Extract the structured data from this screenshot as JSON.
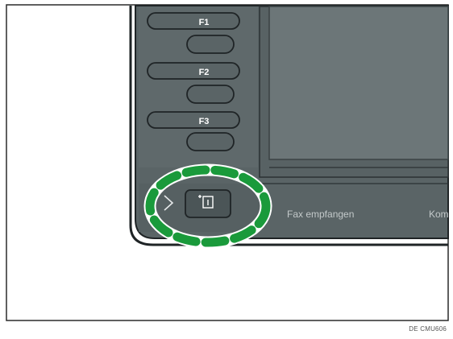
{
  "panel": {
    "function_keys": [
      {
        "label": "F1"
      },
      {
        "label": "F2"
      },
      {
        "label": "F3"
      }
    ],
    "screen_tabs": {
      "fax_received": "Fax empfangen",
      "truncated": "Kom"
    },
    "info_key_icon": "info-key-icon",
    "left_arrow_icon": "chevron-right-icon"
  },
  "highlight": {
    "color": "#1a9a3b",
    "style": "dashed-ellipse"
  },
  "image_code": "DE CMU606",
  "colors": {
    "panel_body": "#5a6466",
    "panel_border": "#2b3133",
    "screen": "#6b7577",
    "key_fill": "#4b5557"
  }
}
